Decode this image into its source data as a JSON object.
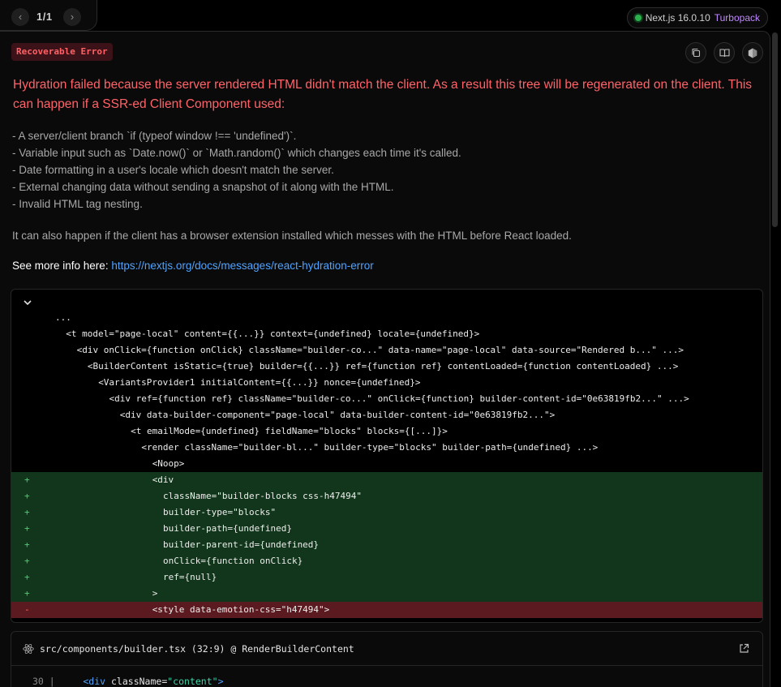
{
  "header": {
    "prev_glyph": "‹",
    "next_glyph": "›",
    "pager": "1/1",
    "framework": "Next.js 16.0.10",
    "bundler": "Turbopack",
    "status_color": "#2bb24c"
  },
  "error": {
    "label": "Recoverable Error",
    "title": "Hydration failed because the server rendered HTML didn't match the client. As a result this tree will be regenerated on the client. This can happen if a SSR-ed Client Component used:",
    "bullets": [
      "- A server/client branch `if (typeof window !== 'undefined')`.",
      "- Variable input such as `Date.now()` or `Math.random()` which changes each time it's called.",
      "- Date formatting in a user's locale which doesn't match the server.",
      "- External changing data without sending a snapshot of it along with the HTML.",
      "- Invalid HTML tag nesting."
    ],
    "extension_note": "It can also happen if the client has a browser extension installed which messes with the HTML before React loaded.",
    "more_info_label": "See more info here:",
    "more_info_url": "https://nextjs.org/docs/messages/react-hydration-error"
  },
  "toolbar": {
    "copy_icon": "copy-icon",
    "docs_icon": "book-icon",
    "nodejs_icon": "nodejs-icon"
  },
  "diff": {
    "toggle_icon": "chevron-down-icon",
    "lines": [
      {
        "type": "ctx",
        "sign": "",
        "indent": 0,
        "text": "..."
      },
      {
        "type": "ctx",
        "sign": "",
        "indent": 1,
        "text": "<t model=\"page-local\" content={{...}} context={undefined} locale={undefined}>"
      },
      {
        "type": "ctx",
        "sign": "",
        "indent": 2,
        "text": "<div onClick={function onClick} className=\"builder-co...\" data-name=\"page-local\" data-source=\"Rendered b...\" ...>"
      },
      {
        "type": "ctx",
        "sign": "",
        "indent": 3,
        "text": "<BuilderContent isStatic={true} builder={{...}} ref={function ref} contentLoaded={function contentLoaded} ...>"
      },
      {
        "type": "ctx",
        "sign": "",
        "indent": 4,
        "text": "<VariantsProvider1 initialContent={{...}} nonce={undefined}>"
      },
      {
        "type": "ctx",
        "sign": "",
        "indent": 5,
        "text": "<div ref={function ref} className=\"builder-co...\" onClick={function} builder-content-id=\"0e63819fb2...\" ...>"
      },
      {
        "type": "ctx",
        "sign": "",
        "indent": 6,
        "text": "<div data-builder-component=\"page-local\" data-builder-content-id=\"0e63819fb2...\">"
      },
      {
        "type": "ctx",
        "sign": "",
        "indent": 7,
        "text": "<t emailMode={undefined} fieldName=\"blocks\" blocks={[...]}>"
      },
      {
        "type": "ctx",
        "sign": "",
        "indent": 8,
        "text": "<render className=\"builder-bl...\" builder-type=\"blocks\" builder-path={undefined} ...>"
      },
      {
        "type": "ctx",
        "sign": "",
        "indent": 9,
        "text": "<Noop>"
      },
      {
        "type": "add",
        "sign": "+",
        "indent": 9,
        "text": "<div"
      },
      {
        "type": "add",
        "sign": "+",
        "indent": 10,
        "text": "className=\"builder-blocks css-h47494\""
      },
      {
        "type": "add",
        "sign": "+",
        "indent": 10,
        "text": "builder-type=\"blocks\""
      },
      {
        "type": "add",
        "sign": "+",
        "indent": 10,
        "text": "builder-path={undefined}"
      },
      {
        "type": "add",
        "sign": "+",
        "indent": 10,
        "text": "builder-parent-id={undefined}"
      },
      {
        "type": "add",
        "sign": "+",
        "indent": 10,
        "text": "onClick={function onClick}"
      },
      {
        "type": "add",
        "sign": "+",
        "indent": 10,
        "text": "ref={null}"
      },
      {
        "type": "add",
        "sign": "+",
        "indent": 9,
        "text": ">"
      },
      {
        "type": "del",
        "sign": "-",
        "indent": 9,
        "text": "<style data-emotion-css=\"h47494\">"
      }
    ]
  },
  "codeframe": {
    "file_icon": "react-icon",
    "path": "src/components/builder.tsx (32:9) @ RenderBuilderContent",
    "open_icon": "external-link-icon",
    "line_number": "30",
    "gutter": "|",
    "code_tag": "<div",
    "code_attr": "className",
    "code_eq": "=",
    "code_value": "\"content\"",
    "code_close": ">"
  }
}
